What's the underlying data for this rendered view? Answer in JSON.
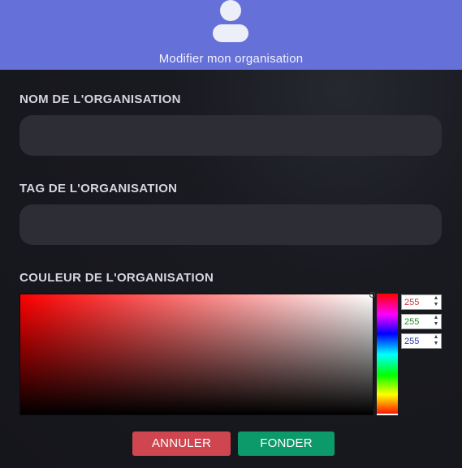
{
  "header": {
    "title": "Modifier mon organisation",
    "icon": "user-avatar-icon",
    "background": "#6670d9"
  },
  "form": {
    "name_label": "NOM DE L'ORGANISATION",
    "name_value": "",
    "tag_label": "TAG DE L'ORGANISATION",
    "tag_value": "",
    "color_label": "COULEUR DE L'ORGANISATION"
  },
  "color_picker": {
    "hue_color": "#ff0000",
    "rgb": {
      "r": "255",
      "g": "255",
      "b": "255"
    },
    "rgb_text_colors": {
      "r": "#c0393b",
      "g": "#2c8a2c",
      "b": "#2a3aa8"
    }
  },
  "actions": {
    "cancel_label": "ANNULER",
    "cancel_color": "#d04650",
    "submit_label": "FONDER",
    "submit_color": "#0d9a6a"
  }
}
